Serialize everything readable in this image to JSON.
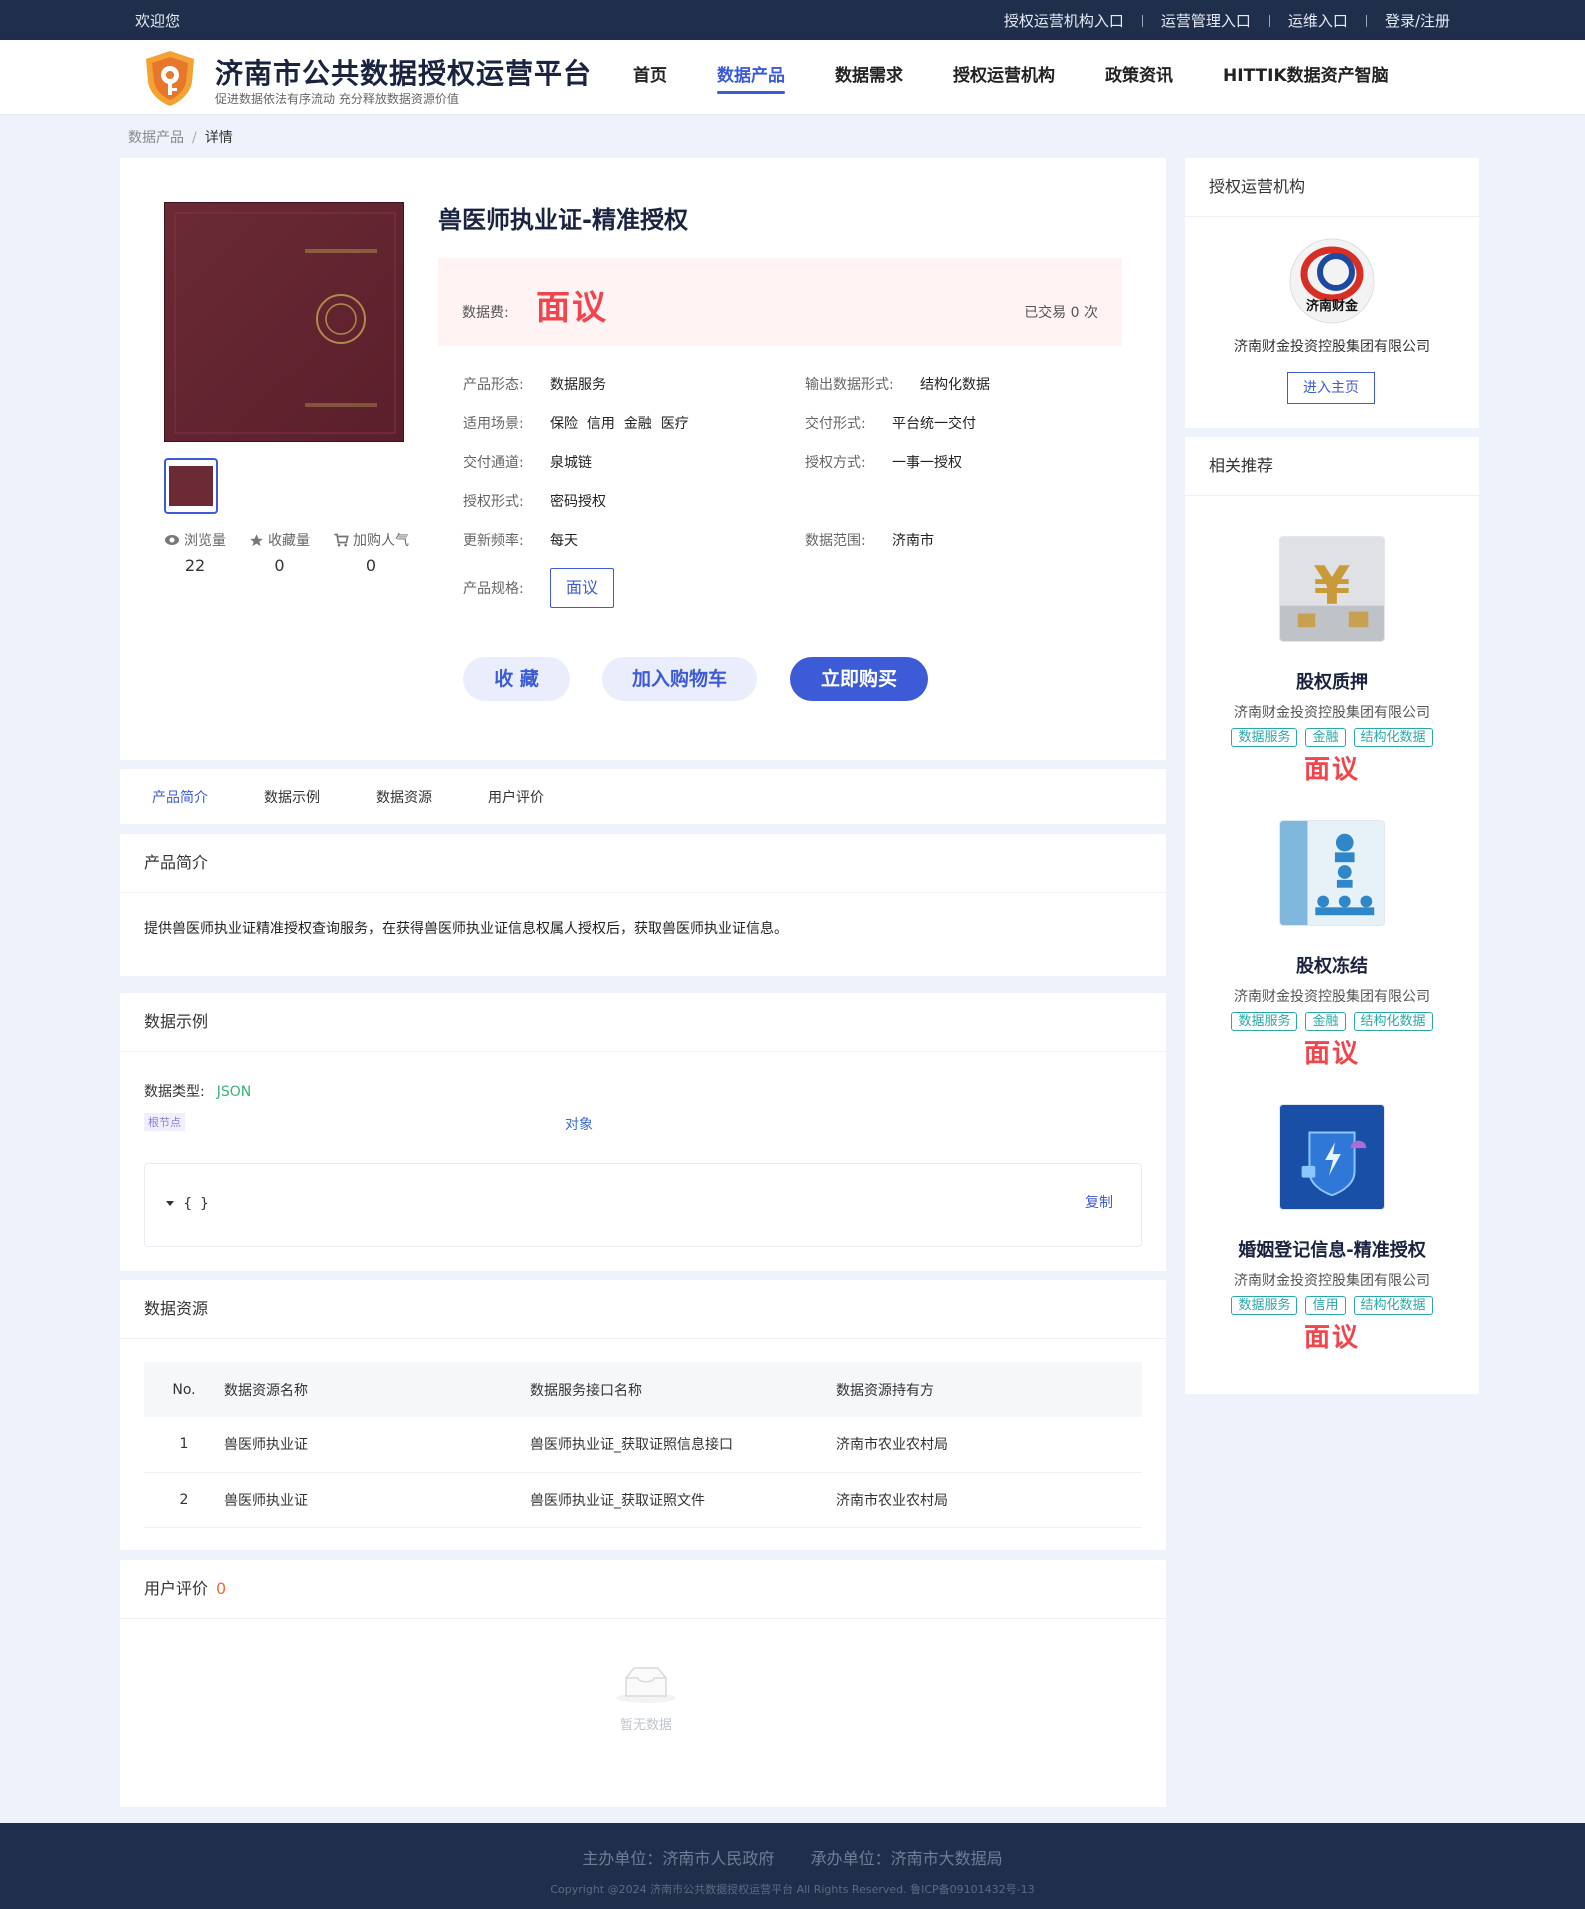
{
  "topbar": {
    "welcome": "欢迎您",
    "links": [
      "授权运营机构入口",
      "运营管理入口",
      "运维入口",
      "登录/注册"
    ]
  },
  "header": {
    "title": "济南市公共数据授权运营平台",
    "subtitle": "促进数据依法有序流动 充分释放数据资源价值",
    "nav": [
      "首页",
      "数据产品",
      "数据需求",
      "授权运营机构",
      "政策资讯",
      "HITTIK数据资产智脑"
    ],
    "active_nav": "数据产品"
  },
  "breadcrumb": {
    "parent": "数据产品",
    "separator": "/",
    "current": "详情"
  },
  "product": {
    "title": "兽医师执业证-精准授权",
    "price_label": "数据费:",
    "price": "面议",
    "traded": "已交易 0 次",
    "stats": [
      {
        "label": "浏览量",
        "value": "22",
        "icon": "eye-icon"
      },
      {
        "label": "收藏量",
        "value": "0",
        "icon": "star-icon"
      },
      {
        "label": "加购人气",
        "value": "0",
        "icon": "cart-icon"
      }
    ],
    "attrs": {
      "form_k": "产品形态:",
      "form_v": "数据服务",
      "output_k": "输出数据形式:",
      "output_v": "结构化数据",
      "scene_k": "适用场景:",
      "scene_v": "保险  信用  金融  医疗",
      "delivery_k": "交付形式:",
      "delivery_v": "平台统一交付",
      "channel_k": "交付通道:",
      "channel_v": "泉城链",
      "auth_k": "授权方式:",
      "auth_v": "一事一授权",
      "authform_k": "授权形式:",
      "authform_v": "密码授权",
      "freq_k": "更新频率:",
      "freq_v": "每天",
      "range_k": "数据范围:",
      "range_v": "济南市",
      "spec_k": "产品规格:",
      "spec_v": "面议"
    },
    "buttons": {
      "fav": "收 藏",
      "cart": "加入购物车",
      "buy": "立即购买"
    }
  },
  "tabs": [
    "产品简介",
    "数据示例",
    "数据资源",
    "用户评价"
  ],
  "intro": {
    "title": "产品简介",
    "text": "提供兽医师执业证精准授权查询服务，在获得兽医师执业证信息权属人授权后，获取兽医师执业证信息。"
  },
  "example": {
    "title": "数据示例",
    "type_label": "数据类型:",
    "type_value": "JSON",
    "root_label": "根节点",
    "object_label": "对象",
    "code": "{ }",
    "copy": "复制"
  },
  "resource": {
    "title": "数据资源",
    "headers": [
      "No.",
      "数据资源名称",
      "数据服务接口名称",
      "数据资源持有方"
    ],
    "rows": [
      [
        "1",
        "兽医师执业证",
        "兽医师执业证_获取证照信息接口",
        "济南市农业农村局"
      ],
      [
        "2",
        "兽医师执业证",
        "兽医师执业证_获取证照文件",
        "济南市农业农村局"
      ]
    ]
  },
  "review": {
    "title": "用户评价",
    "count": "0",
    "empty": "暂无数据"
  },
  "org": {
    "title": "授权运营机构",
    "logo_text": "济南财金",
    "name": "济南财金投资控股集团有限公司",
    "enter": "进入主页"
  },
  "recommend": {
    "title": "相关推荐",
    "items": [
      {
        "title": "股权质押",
        "company": "济南财金投资控股集团有限公司",
        "tags": [
          "数据服务",
          "金融",
          "结构化数据"
        ],
        "price": "面议"
      },
      {
        "title": "股权冻结",
        "company": "济南财金投资控股集团有限公司",
        "tags": [
          "数据服务",
          "金融",
          "结构化数据"
        ],
        "price": "面议"
      },
      {
        "title": "婚姻登记信息-精准授权",
        "company": "济南财金投资控股集团有限公司",
        "tags": [
          "数据服务",
          "信用",
          "结构化数据"
        ],
        "price": "面议"
      }
    ]
  },
  "footer": {
    "line1": "主办单位：济南市人民政府    承办单位：济南市大数据局",
    "line2": "Copyright @2024 济南市公共数据授权运营平台 All Rights Reserved. 鲁ICP备09101432号-13"
  },
  "colors": {
    "accent": "#3d5bd6",
    "price": "#f0454d",
    "topbar": "#1f2e4b",
    "tag": "#2aa8a8"
  }
}
